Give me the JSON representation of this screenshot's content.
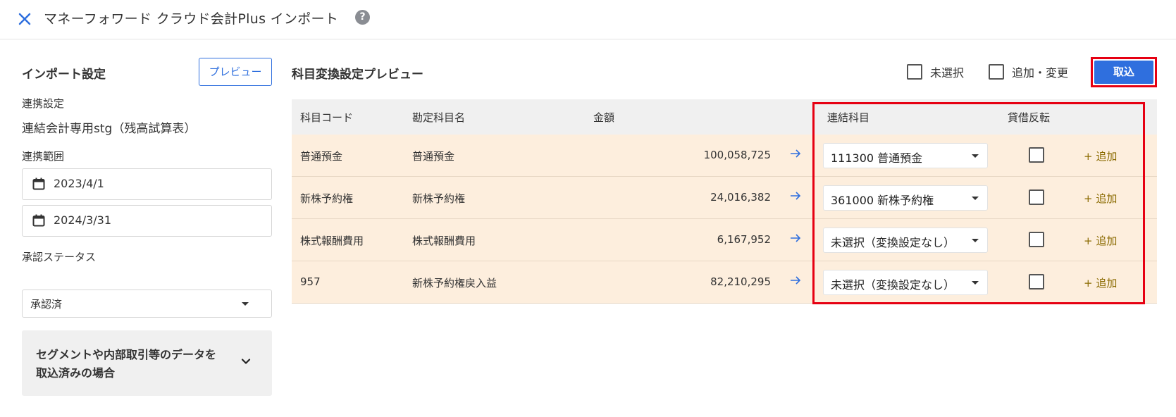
{
  "header": {
    "title": "マネーフォワード クラウド会計Plus インポート",
    "help": "?"
  },
  "left": {
    "section_title": "インポート設定",
    "preview_button": "プレビュー",
    "link_label": "連携設定",
    "link_value": "連結会計専用stg（残高試算表）",
    "range_label": "連携範囲",
    "start_date": "2023/4/1",
    "end_date": "2024/3/31",
    "approval_label": "承認ステータス",
    "approval_value": "承認済",
    "accordion_text": "セグメントや内部取引等のデータを取込済みの場合"
  },
  "right": {
    "title": "科目変換設定プレビュー",
    "filter_unselected": "未選択",
    "filter_added": "追加・変更",
    "import_button": "取込"
  },
  "table": {
    "headers": {
      "code": "科目コード",
      "name": "勘定科目名",
      "amount": "金額",
      "linked": "連結科目",
      "reverse": "貸借反転"
    },
    "rows": [
      {
        "code": "普通預金",
        "name": "普通預金",
        "amount": "100,058,725",
        "linked": "111300 普通預金",
        "add": "+ 追加"
      },
      {
        "code": "新株予約権",
        "name": "新株予約権",
        "amount": "24,016,382",
        "linked": "361000 新株予約権",
        "add": "+ 追加"
      },
      {
        "code": "株式報酬費用",
        "name": "株式報酬費用",
        "amount": "6,167,952",
        "linked": "未選択（変換設定なし）",
        "add": "+ 追加"
      },
      {
        "code": "957",
        "name": "新株予約権戻入益",
        "amount": "82,210,295",
        "linked": "未選択（変換設定なし）",
        "add": "+ 追加"
      }
    ]
  },
  "colors": {
    "accent": "#2f6fde",
    "highlight": "#e60012",
    "row_bg": "#fdeedd"
  }
}
